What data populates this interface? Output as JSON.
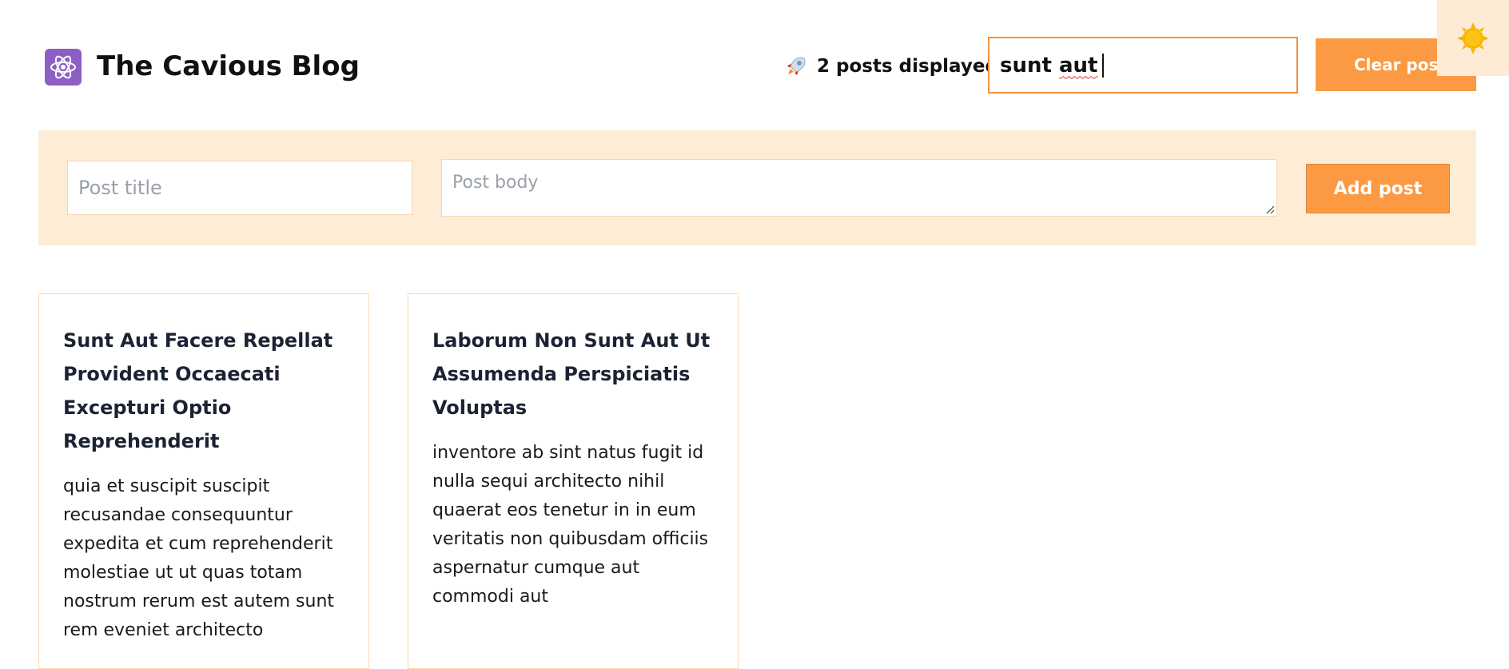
{
  "header": {
    "logo_icon": "atom-icon",
    "title": "The Cavious Blog",
    "post_count_icon": "rocket-icon",
    "post_count_text": "2 posts displayed",
    "search": {
      "value_word1": "sunt",
      "value_word2": "aut",
      "placeholder": ""
    },
    "clear_button_label": "Clear posts",
    "theme_toggle_icon": "sun-icon"
  },
  "form": {
    "title_placeholder": "Post title",
    "body_placeholder": "Post body",
    "add_button_label": "Add post"
  },
  "posts": [
    {
      "title": "Sunt Aut Facere Repellat Provident Occaecati Excepturi Optio Reprehenderit",
      "body": "quia et suscipit suscipit recusandae consequuntur expedita et cum reprehenderit molestiae ut ut quas totam nostrum rerum est autem sunt rem eveniet architecto"
    },
    {
      "title": "Laborum Non Sunt Aut Ut Assumenda Perspiciatis Voluptas",
      "body": "inventore ab sint natus fugit id nulla sequi architecto nihil quaerat eos tenetur in in eum veritatis non quibusdam officiis aspernatur cumque aut commodi aut"
    }
  ],
  "colors": {
    "accent": "#fb9a43",
    "form_background": "#fdecd6",
    "logo_background": "#8c5fc4",
    "sun": "#f7b500"
  }
}
